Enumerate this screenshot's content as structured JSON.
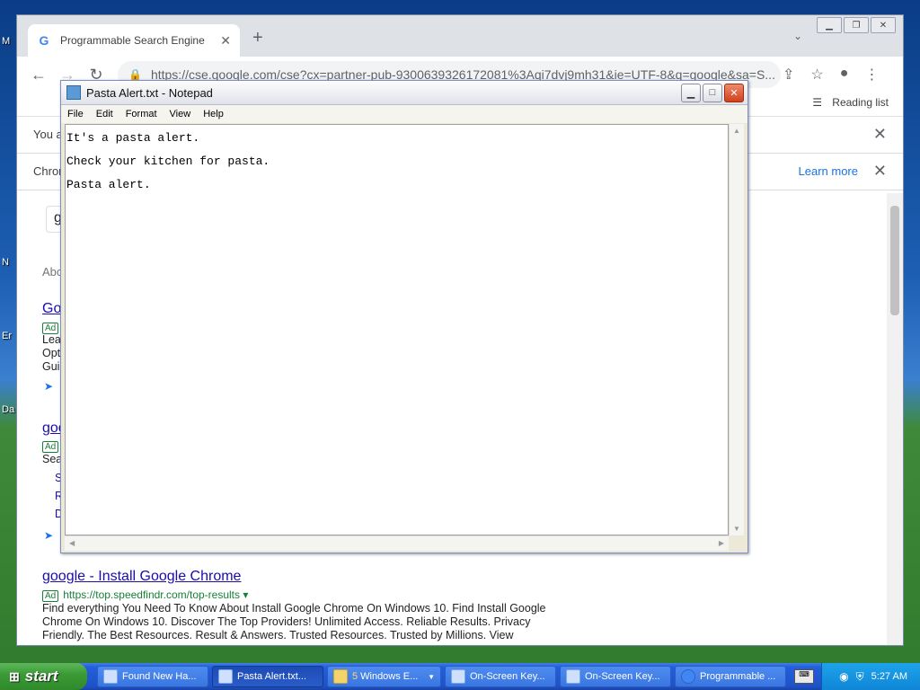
{
  "desktop": {
    "labels": [
      "M",
      "N",
      "Er",
      "Da"
    ]
  },
  "chrome": {
    "tab_title": "Programmable Search Engine",
    "url": "https://cse.google.com/cse?cx=partner-pub-9300639326172081%3Aqi7dvj9mh31&ie=UTF-8&q=google&sa=S...",
    "reading_list": "Reading list",
    "infobar1_text": "You a",
    "infobar2_text": "Chron",
    "learn_more": "Learn more",
    "page": {
      "search_partial": "g",
      "about_partial": "Abo",
      "result1_partial": "Go",
      "result2_partial": "goo",
      "ad_label": "Ad",
      "partial_lines": [
        "Lea",
        "Opt",
        "Gui",
        "Sea",
        "S",
        "R",
        "D"
      ],
      "result3": {
        "title": "google - Install Google Chrome",
        "url": "https://top.speedfindr.com/top-results",
        "desc": "Find everything You Need To Know About Install Google Chrome On Windows 10. Find Install Google Chrome On Windows 10. Discover The Top Providers! Unlimited Access. Reliable Results. Privacy Friendly. The Best Resources. Result & Answers. Trusted Resources. Trusted by Millions. View"
      }
    }
  },
  "notepad": {
    "title": "Pasta Alert.txt - Notepad",
    "menu": [
      "File",
      "Edit",
      "Format",
      "View",
      "Help"
    ],
    "lines": [
      "It's a pasta alert.",
      "Check your kitchen for pasta.",
      "Pasta alert."
    ]
  },
  "taskbar": {
    "start_label": "start",
    "buttons": [
      {
        "label": "Found New Ha..."
      },
      {
        "label": "Pasta Alert.txt..."
      },
      {
        "count": "5",
        "label": "Windows E..."
      },
      {
        "label": "On-Screen Key..."
      },
      {
        "label": "On-Screen Key..."
      },
      {
        "label": "Programmable ..."
      }
    ],
    "clock": "5:27 AM"
  }
}
